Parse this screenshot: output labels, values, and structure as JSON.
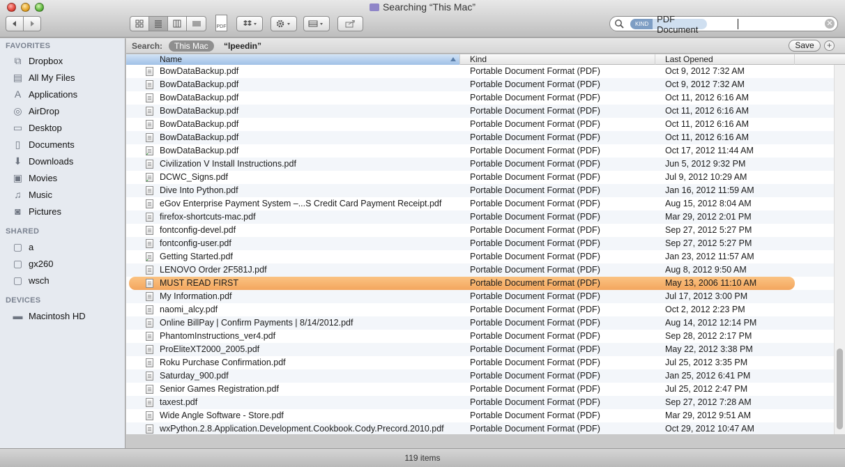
{
  "window": {
    "title": "Searching “This Mac”"
  },
  "toolbar": {
    "back_icon": "back-arrow-icon",
    "forward_icon": "forward-arrow-icon",
    "view_icons": [
      "icon-view-icon",
      "list-view-icon",
      "column-view-icon",
      "coverflow-view-icon"
    ],
    "pdf_badge": "PDF"
  },
  "search": {
    "token_kind": "KIND",
    "token_value": "PDF Document"
  },
  "sidebar": {
    "favorites_header": "FAVORITES",
    "favorites": [
      {
        "label": "Dropbox",
        "icon": "dropbox-icon"
      },
      {
        "label": "All My Files",
        "icon": "all-files-icon"
      },
      {
        "label": "Applications",
        "icon": "applications-icon"
      },
      {
        "label": "AirDrop",
        "icon": "airdrop-icon"
      },
      {
        "label": "Desktop",
        "icon": "desktop-icon"
      },
      {
        "label": "Documents",
        "icon": "documents-icon"
      },
      {
        "label": "Downloads",
        "icon": "downloads-icon"
      },
      {
        "label": "Movies",
        "icon": "movies-icon"
      },
      {
        "label": "Music",
        "icon": "music-icon"
      },
      {
        "label": "Pictures",
        "icon": "pictures-icon"
      }
    ],
    "shared_header": "SHARED",
    "shared": [
      {
        "label": "a",
        "icon": "computer-icon"
      },
      {
        "label": "gx260",
        "icon": "computer-icon"
      },
      {
        "label": "wsch",
        "icon": "computer-icon"
      }
    ],
    "devices_header": "DEVICES",
    "devices": [
      {
        "label": "Macintosh HD",
        "icon": "hard-drive-icon"
      }
    ]
  },
  "scope": {
    "label": "Search:",
    "this_mac": "This Mac",
    "user": "“lpeedin”",
    "save_label": "Save",
    "add_label": "+"
  },
  "table": {
    "columns": [
      "Name",
      "Kind",
      "Last Opened"
    ],
    "rows": [
      {
        "name": "BowDataBackup.pdf",
        "kind": "Portable Document Format (PDF)",
        "date": "Oct 9, 2012  7:32 AM",
        "check": false
      },
      {
        "name": "BowDataBackup.pdf",
        "kind": "Portable Document Format (PDF)",
        "date": "Oct 9, 2012  7:32 AM",
        "check": false
      },
      {
        "name": "BowDataBackup.pdf",
        "kind": "Portable Document Format (PDF)",
        "date": "Oct 11, 2012  6:16 AM",
        "check": false
      },
      {
        "name": "BowDataBackup.pdf",
        "kind": "Portable Document Format (PDF)",
        "date": "Oct 11, 2012  6:16 AM",
        "check": false
      },
      {
        "name": "BowDataBackup.pdf",
        "kind": "Portable Document Format (PDF)",
        "date": "Oct 11, 2012  6:16 AM",
        "check": false
      },
      {
        "name": "BowDataBackup.pdf",
        "kind": "Portable Document Format (PDF)",
        "date": "Oct 11, 2012  6:16 AM",
        "check": false
      },
      {
        "name": "BowDataBackup.pdf",
        "kind": "Portable Document Format (PDF)",
        "date": "Oct 17, 2012  11:44 AM",
        "check": true
      },
      {
        "name": "Civilization V Install Instructions.pdf",
        "kind": "Portable Document Format (PDF)",
        "date": "Jun 5, 2012  9:32 PM",
        "check": false
      },
      {
        "name": "DCWC_Signs.pdf",
        "kind": "Portable Document Format (PDF)",
        "date": "Jul 9, 2012  10:29 AM",
        "check": true
      },
      {
        "name": "Dive Into Python.pdf",
        "kind": "Portable Document Format (PDF)",
        "date": "Jan 16, 2012  11:59 AM",
        "check": false
      },
      {
        "name": "eGov Enterprise Payment System –...S Credit Card Payment Receipt.pdf",
        "kind": "Portable Document Format (PDF)",
        "date": "Aug 15, 2012  8:04 AM",
        "check": false
      },
      {
        "name": "firefox-shortcuts-mac.pdf",
        "kind": "Portable Document Format (PDF)",
        "date": "Mar 29, 2012  2:01 PM",
        "check": false
      },
      {
        "name": "fontconfig-devel.pdf",
        "kind": "Portable Document Format (PDF)",
        "date": "Sep 27, 2012  5:27 PM",
        "check": false
      },
      {
        "name": "fontconfig-user.pdf",
        "kind": "Portable Document Format (PDF)",
        "date": "Sep 27, 2012  5:27 PM",
        "check": false
      },
      {
        "name": "Getting Started.pdf",
        "kind": "Portable Document Format (PDF)",
        "date": "Jan 23, 2012  11:57 AM",
        "check": true
      },
      {
        "name": "LENOVO Order 2F581J.pdf",
        "kind": "Portable Document Format (PDF)",
        "date": "Aug 8, 2012  9:50 AM",
        "check": false
      },
      {
        "name": "MUST READ FIRST",
        "kind": "Portable Document Format (PDF)",
        "date": "May 13, 2006  11:10 AM",
        "check": false,
        "selected": true
      },
      {
        "name": "My Information.pdf",
        "kind": "Portable Document Format (PDF)",
        "date": "Jul 17, 2012  3:00 PM",
        "check": false
      },
      {
        "name": "naomi_alcy.pdf",
        "kind": "Portable Document Format (PDF)",
        "date": "Oct 2, 2012  2:23 PM",
        "check": false
      },
      {
        "name": "Online BillPay | Confirm Payments | 8/14/2012.pdf",
        "kind": "Portable Document Format (PDF)",
        "date": "Aug 14, 2012  12:14 PM",
        "check": false
      },
      {
        "name": "PhantomInstructions_ver4.pdf",
        "kind": "Portable Document Format (PDF)",
        "date": "Sep 28, 2012  2:17 PM",
        "check": false
      },
      {
        "name": "ProEliteXT2000_2005.pdf",
        "kind": "Portable Document Format (PDF)",
        "date": "May 22, 2012  3:38 PM",
        "check": false
      },
      {
        "name": "Roku Purchase Confirmation.pdf",
        "kind": "Portable Document Format (PDF)",
        "date": "Jul 25, 2012  3:35 PM",
        "check": false
      },
      {
        "name": "Saturday_900.pdf",
        "kind": "Portable Document Format (PDF)",
        "date": "Jan 25, 2012  6:41 PM",
        "check": false
      },
      {
        "name": "Senior Games Registration.pdf",
        "kind": "Portable Document Format (PDF)",
        "date": "Jul 25, 2012  2:47 PM",
        "check": false
      },
      {
        "name": "taxest.pdf",
        "kind": "Portable Document Format (PDF)",
        "date": "Sep 27, 2012  7:28 AM",
        "check": false
      },
      {
        "name": "Wide Angle Software - Store.pdf",
        "kind": "Portable Document Format (PDF)",
        "date": "Mar 29, 2012  9:51 AM",
        "check": false
      },
      {
        "name": "wxPython.2.8.Application.Development.Cookbook.Cody.Precord.2010.pdf",
        "kind": "Portable Document Format (PDF)",
        "date": "Oct 29, 2012  10:47 AM",
        "check": false
      }
    ]
  },
  "status": {
    "item_count": "119 items"
  }
}
